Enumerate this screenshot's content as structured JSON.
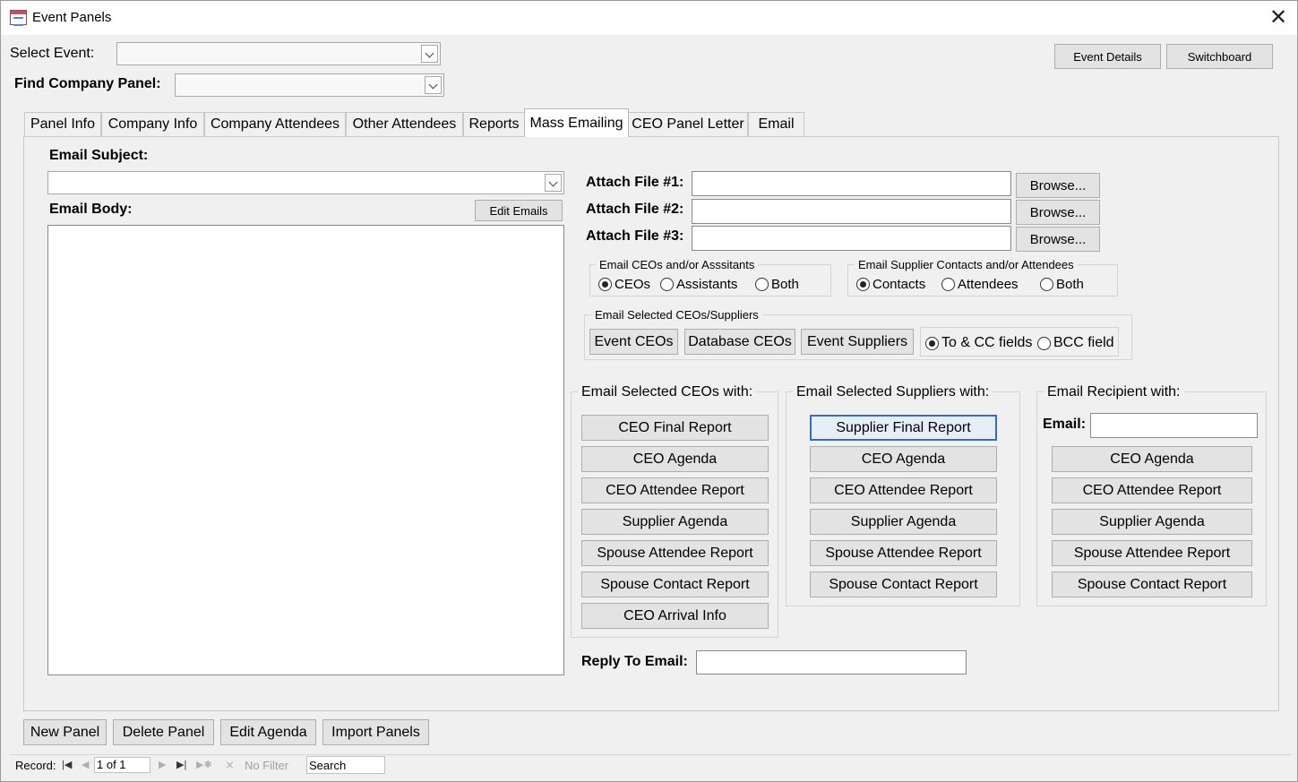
{
  "window": {
    "title": "Event Panels"
  },
  "header": {
    "select_event_label": "Select Event:",
    "select_event_value": "",
    "find_company_label": "Find Company Panel:",
    "find_company_value": "",
    "event_details_btn": "Event Details",
    "switchboard_btn": "Switchboard"
  },
  "tabs": [
    {
      "label": "Panel Info"
    },
    {
      "label": "Company Info"
    },
    {
      "label": "Company Attendees"
    },
    {
      "label": "Other Attendees"
    },
    {
      "label": "Reports"
    },
    {
      "label": "Mass Emailing"
    },
    {
      "label": "CEO Panel Letter"
    },
    {
      "label": "Email"
    }
  ],
  "mass_emailing": {
    "email_subject_label": "Email Subject:",
    "email_subject_value": "",
    "email_body_label": "Email Body:",
    "edit_emails_btn": "Edit Emails",
    "email_body_value": "",
    "attachments": [
      {
        "label": "Attach File #1:",
        "value": "",
        "browse": "Browse..."
      },
      {
        "label": "Attach File #2:",
        "value": "",
        "browse": "Browse..."
      },
      {
        "label": "Attach File #3:",
        "value": "",
        "browse": "Browse..."
      }
    ],
    "ceo_group": {
      "title": "Email CEOs and/or Asssitants",
      "options": [
        "CEOs",
        "Assistants",
        "Both"
      ],
      "selected": "CEOs"
    },
    "supplier_group": {
      "title": "Email Supplier Contacts and/or Attendees",
      "options": [
        "Contacts",
        "Attendees",
        "Both"
      ],
      "selected": "Contacts"
    },
    "selected_group": {
      "title": "Email Selected CEOs/Suppliers",
      "buttons": [
        "Event CEOs",
        "Database CEOs",
        "Event Suppliers"
      ],
      "field_options": [
        "To & CC fields",
        "BCC field"
      ],
      "field_selected": "To & CC fields"
    },
    "ceo_reports": {
      "title": "Email Selected CEOs with:",
      "buttons": [
        "CEO Final Report",
        "CEO Agenda",
        "CEO Attendee Report",
        "Supplier Agenda",
        "Spouse Attendee Report",
        "Spouse Contact Report",
        "CEO Arrival Info"
      ]
    },
    "supplier_reports": {
      "title": "Email Selected Suppliers with:",
      "buttons": [
        "Supplier Final Report",
        "CEO Agenda",
        "CEO Attendee Report",
        "Supplier Agenda",
        "Spouse Attendee Report",
        "Spouse Contact Report"
      ]
    },
    "recipient_reports": {
      "title": "Email Recipient with:",
      "email_label": "Email:",
      "email_value": "",
      "buttons": [
        "CEO Agenda",
        "CEO Attendee Report",
        "Supplier Agenda",
        "Spouse Attendee Report",
        "Spouse Contact Report"
      ]
    },
    "reply_to_label": "Reply To Email:",
    "reply_to_value": ""
  },
  "footer": {
    "buttons": [
      "New Panel",
      "Delete Panel",
      "Edit Agenda",
      "Import Panels"
    ]
  },
  "statusbar": {
    "record_label": "Record:",
    "record_value": "1 of 1",
    "filter_label": "No Filter",
    "search_placeholder": "Search"
  },
  "colors": {
    "focus_border": "#2b6fc7",
    "button_face": "#e3e3e3",
    "window_bg": "#f0f0f0"
  }
}
